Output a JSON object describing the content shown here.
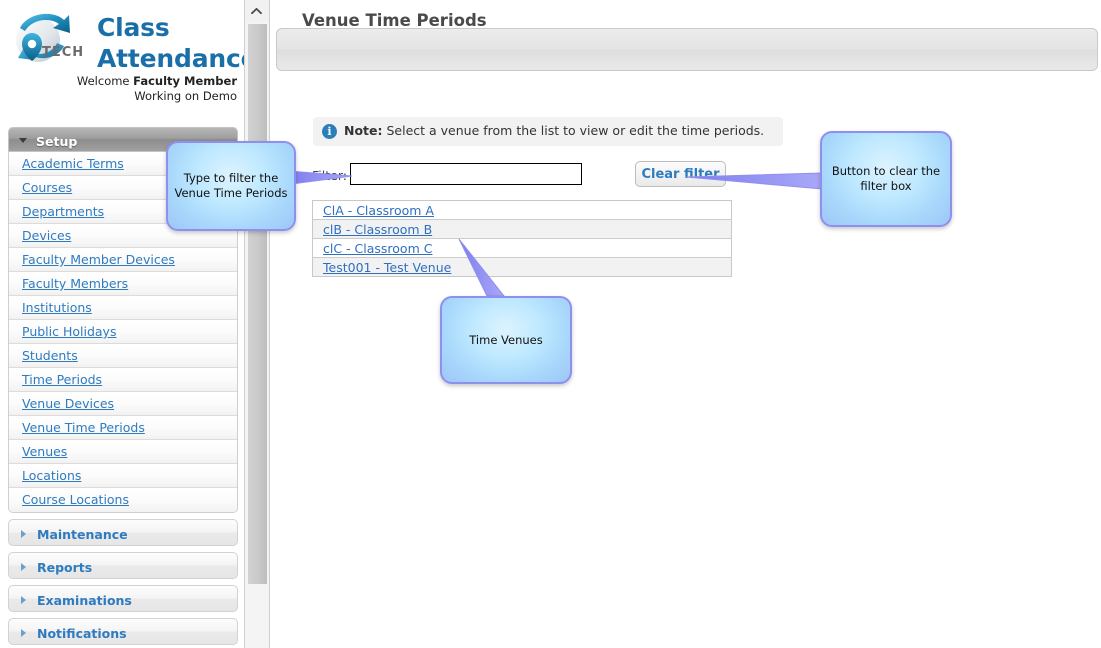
{
  "brand": {
    "logo_icon": "iptech-globe-logo",
    "title_line1": "Class",
    "title_line2": "Attendance",
    "welcome_prefix": "Welcome ",
    "welcome_user": "Faculty Member",
    "working_on": "Working on Demo"
  },
  "sidebar": {
    "expanded_section": {
      "label": "Setup",
      "expand_icon": "triangle-down-icon",
      "items": [
        {
          "label": "Academic Terms"
        },
        {
          "label": "Courses"
        },
        {
          "label": "Departments"
        },
        {
          "label": "Devices"
        },
        {
          "label": "Faculty Member Devices"
        },
        {
          "label": "Faculty Members"
        },
        {
          "label": "Institutions"
        },
        {
          "label": "Public Holidays"
        },
        {
          "label": "Students"
        },
        {
          "label": "Time Periods"
        },
        {
          "label": "Venue Devices"
        },
        {
          "label": "Venue Time Periods"
        },
        {
          "label": "Venues"
        },
        {
          "label": "Locations"
        },
        {
          "label": "Course Locations"
        }
      ]
    },
    "collapsed_sections": [
      {
        "label": "Maintenance",
        "expand_icon": "triangle-right-icon"
      },
      {
        "label": "Reports",
        "expand_icon": "triangle-right-icon"
      },
      {
        "label": "Examinations",
        "expand_icon": "triangle-right-icon"
      },
      {
        "label": "Notifications",
        "expand_icon": "triangle-right-icon"
      }
    ]
  },
  "scrollbar": {
    "up_arrow_icon": "chevron-up-icon"
  },
  "main": {
    "page_title": "Venue Time Periods",
    "note": {
      "icon": "info-icon",
      "bold_prefix": "Note:",
      "text": " Select a venue from the list to view or edit the time periods."
    },
    "filter": {
      "label": "Filter:",
      "value": "",
      "placeholder": "",
      "clear_button_label": "Clear filter"
    },
    "venue_list": [
      {
        "label": "ClA - Classroom A"
      },
      {
        "label": "clB - Classroom B"
      },
      {
        "label": "clC - Classroom C"
      },
      {
        "label": "Test001 - Test Venue"
      }
    ]
  },
  "callouts": {
    "filter_box": "Type to filter the Venue Time Periods",
    "clear_button": "Button to clear the filter box",
    "venue_list": "Time Venues"
  },
  "colors": {
    "brand_blue": "#1a6fa8",
    "link_blue": "#2f7bbf",
    "callout_fill": "#bfe9ff",
    "callout_border": "#8f8ff0",
    "info_icon": "#2a7fb8"
  }
}
